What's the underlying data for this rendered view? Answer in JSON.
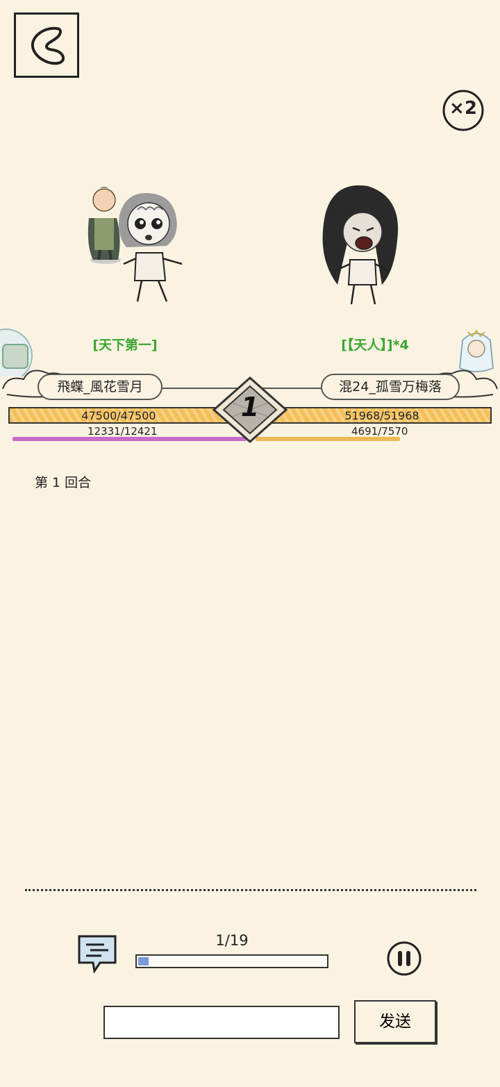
{
  "speed": {
    "label": "×2"
  },
  "player_left": {
    "title": "[天下第一]",
    "name": "飛蝶_風花雪月",
    "hp": "47500/47500",
    "hp_fraction": 1.0,
    "mp": "12331/12421",
    "mp_fraction": 0.99
  },
  "player_right": {
    "title": "[【天人】]*4",
    "name": "混24_孤雪万梅落",
    "hp": "51968/51968",
    "hp_fraction": 1.0,
    "mp": "4691/7570",
    "mp_fraction": 0.62
  },
  "round": {
    "number": "1"
  },
  "battle_log": [
    "第 1 回合"
  ],
  "playback": {
    "progress_label": "1/19",
    "progress_fraction": 0.053
  },
  "chat": {
    "input_value": "",
    "send_label": "发送"
  },
  "colors": {
    "background": "#fbf3e2",
    "title_green": "#3da534",
    "hp_bar": "#f4bf5a",
    "mp_left": "#c96cc9",
    "mp_right": "#eeb958",
    "progress": "#7b9bd7"
  },
  "icons": [
    "back-chevron-icon",
    "speed-x2-icon",
    "round-badge",
    "chat-bubble-icon",
    "pause-icon"
  ]
}
